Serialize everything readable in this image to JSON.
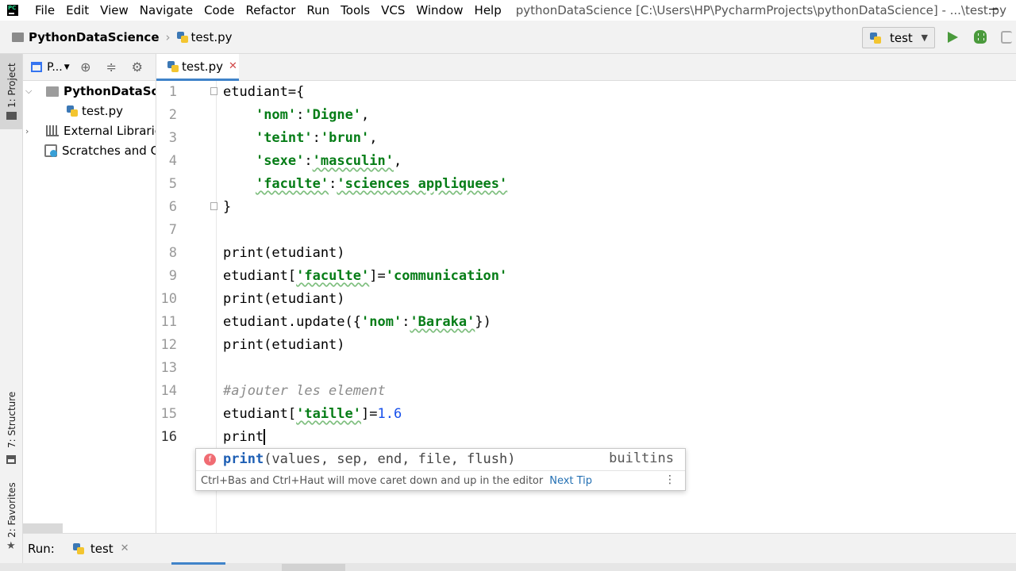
{
  "menubar": {
    "items": [
      "File",
      "Edit",
      "View",
      "Navigate",
      "Code",
      "Refactor",
      "Run",
      "Tools",
      "VCS",
      "Window",
      "Help"
    ],
    "window_title": "pythonDataScience [C:\\Users\\HP\\PycharmProjects\\pythonDataScience] - ...\\test.py"
  },
  "navbar": {
    "project": "PythonDataScience",
    "file": "test.py",
    "run_config": "test"
  },
  "side_tabs": {
    "project": "1: Project",
    "structure": "7: Structure",
    "favorites": "2: Favorites"
  },
  "project_panel": {
    "title": "P...",
    "tree": [
      {
        "label": "PythonDataScience",
        "type": "folder",
        "expanded": true
      },
      {
        "label": "test.py",
        "type": "python-file"
      },
      {
        "label": "External Libraries",
        "type": "library"
      },
      {
        "label": "Scratches and Consoles",
        "type": "scratch"
      }
    ]
  },
  "editor": {
    "tab": "test.py",
    "current_line": 16,
    "lines": [
      {
        "n": "1",
        "parts": [
          {
            "t": "etudiant={",
            "c": ""
          }
        ]
      },
      {
        "n": "2",
        "parts": [
          {
            "t": "    ",
            "c": ""
          },
          {
            "t": "'nom'",
            "c": "key"
          },
          {
            "t": ":",
            "c": ""
          },
          {
            "t": "'Digne'",
            "c": "str"
          },
          {
            "t": ",",
            "c": ""
          }
        ]
      },
      {
        "n": "3",
        "parts": [
          {
            "t": "    ",
            "c": ""
          },
          {
            "t": "'teint'",
            "c": "key"
          },
          {
            "t": ":",
            "c": ""
          },
          {
            "t": "'brun'",
            "c": "str"
          },
          {
            "t": ",",
            "c": ""
          }
        ]
      },
      {
        "n": "4",
        "parts": [
          {
            "t": "    ",
            "c": ""
          },
          {
            "t": "'sexe'",
            "c": "key"
          },
          {
            "t": ":",
            "c": ""
          },
          {
            "t": "'masculin'",
            "c": "str wavy"
          },
          {
            "t": ",",
            "c": ""
          }
        ]
      },
      {
        "n": "5",
        "parts": [
          {
            "t": "    ",
            "c": ""
          },
          {
            "t": "'faculte'",
            "c": "key wavy"
          },
          {
            "t": ":",
            "c": ""
          },
          {
            "t": "'sciences appliquees'",
            "c": "str wavy"
          }
        ]
      },
      {
        "n": "6",
        "parts": [
          {
            "t": "}",
            "c": ""
          }
        ]
      },
      {
        "n": "7",
        "parts": []
      },
      {
        "n": "8",
        "parts": [
          {
            "t": "print(etudiant)",
            "c": ""
          }
        ]
      },
      {
        "n": "9",
        "parts": [
          {
            "t": "etudiant[",
            "c": ""
          },
          {
            "t": "'faculte'",
            "c": "key wavy"
          },
          {
            "t": "]=",
            "c": ""
          },
          {
            "t": "'communication'",
            "c": "str"
          }
        ]
      },
      {
        "n": "10",
        "parts": [
          {
            "t": "print(etudiant)",
            "c": ""
          }
        ]
      },
      {
        "n": "11",
        "parts": [
          {
            "t": "etudiant.update({",
            "c": ""
          },
          {
            "t": "'nom'",
            "c": "key"
          },
          {
            "t": ":",
            "c": ""
          },
          {
            "t": "'Baraka'",
            "c": "str wavy"
          },
          {
            "t": "})",
            "c": ""
          }
        ]
      },
      {
        "n": "12",
        "parts": [
          {
            "t": "print(etudiant)",
            "c": ""
          }
        ]
      },
      {
        "n": "13",
        "parts": []
      },
      {
        "n": "14",
        "parts": [
          {
            "t": "#ajouter les element",
            "c": "cmt"
          }
        ]
      },
      {
        "n": "15",
        "parts": [
          {
            "t": "etudiant[",
            "c": ""
          },
          {
            "t": "'taille'",
            "c": "key wavy"
          },
          {
            "t": "]=",
            "c": ""
          },
          {
            "t": "1.6",
            "c": "num"
          }
        ]
      },
      {
        "n": "16",
        "parts": [
          {
            "t": "print",
            "c": ""
          }
        ]
      }
    ]
  },
  "completion": {
    "kind_icon": "f",
    "name": "print",
    "signature": "(values, sep, end, file, flush)",
    "module": "builtins",
    "tip": "Ctrl+Bas and Ctrl+Haut will move caret down and up in the editor",
    "next_tip": "Next Tip"
  },
  "run_bar": {
    "label": "Run:",
    "config": "test"
  },
  "colors": {
    "string": "#067d17",
    "number": "#1750eb",
    "comment": "#8c8c8c",
    "accent": "#4083c9",
    "run_green": "#4a9a3c"
  }
}
